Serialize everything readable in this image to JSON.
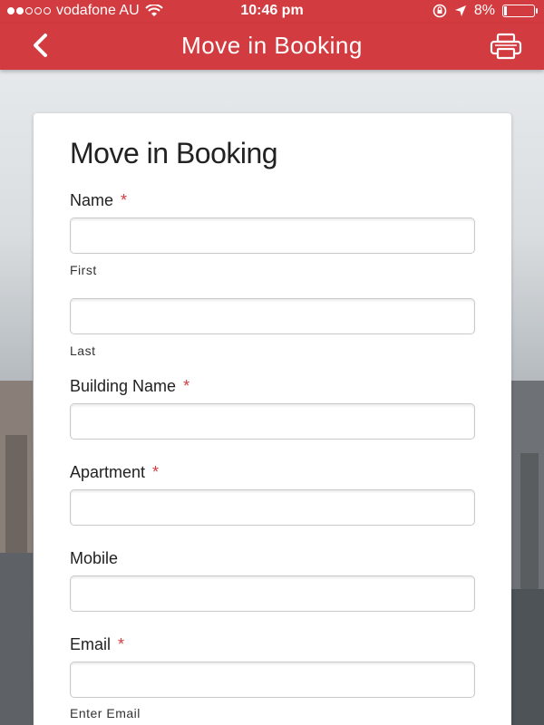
{
  "status_bar": {
    "carrier": "vodafone AU",
    "time": "10:46 pm",
    "battery": "8%",
    "battery_level": 0.08
  },
  "navbar": {
    "title": "Move in Booking",
    "back_icon": "chevron-left-icon",
    "print_icon": "printer-icon"
  },
  "form": {
    "title": "Move in Booking",
    "required_marker": "*",
    "name": {
      "label": "Name",
      "first_sublabel": "First",
      "last_sublabel": "Last",
      "first_value": "",
      "last_value": ""
    },
    "building": {
      "label": "Building Name",
      "value": ""
    },
    "apartment": {
      "label": "Apartment",
      "value": ""
    },
    "mobile": {
      "label": "Mobile",
      "value": ""
    },
    "email": {
      "label": "Email",
      "sublabel": "Enter Email",
      "value": ""
    }
  },
  "colors": {
    "accent": "#d23b3f",
    "required": "#d23b3f"
  }
}
